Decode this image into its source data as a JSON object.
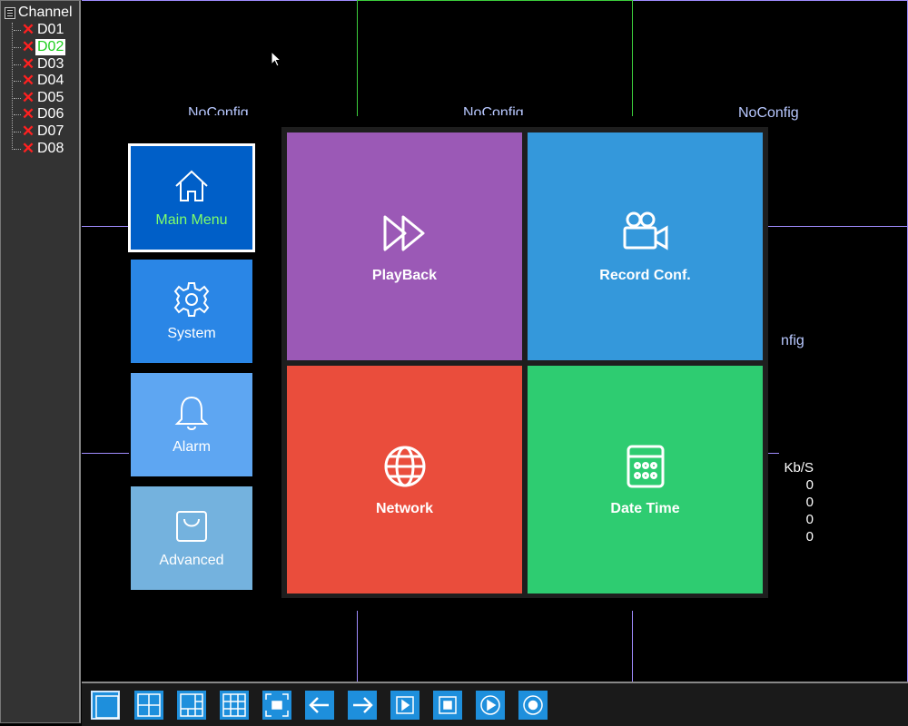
{
  "sidebar": {
    "title": "Channel",
    "channels": [
      {
        "label": "D01",
        "selected": false
      },
      {
        "label": "D02",
        "selected": true
      },
      {
        "label": "D03",
        "selected": false
      },
      {
        "label": "D04",
        "selected": false
      },
      {
        "label": "D05",
        "selected": false
      },
      {
        "label": "D06",
        "selected": false
      },
      {
        "label": "D07",
        "selected": false
      },
      {
        "label": "D08",
        "selected": false
      }
    ]
  },
  "video": {
    "noconfig_text": "NoConfig",
    "noconfig_partial": "nfig",
    "bitrate_header": "Kb/S",
    "bitrate_values": [
      "0",
      "0",
      "0",
      "0"
    ]
  },
  "nav": {
    "main_menu": "Main Menu",
    "system": "System",
    "alarm": "Alarm",
    "advanced": "Advanced"
  },
  "tiles": {
    "playback": "PlayBack",
    "record": "Record Conf.",
    "network": "Network",
    "datetime": "Date Time"
  },
  "toolbar": {
    "buttons": [
      "single-view-icon",
      "quad-view-icon",
      "six-view-icon",
      "nine-view-icon",
      "fullscreen-icon",
      "previous-arrow-icon",
      "next-arrow-icon",
      "play-icon",
      "stop-icon",
      "playback-icon",
      "record-icon"
    ]
  },
  "colors": {
    "playback": "#9b59b6",
    "record": "#3498db",
    "network": "#ea4d3c",
    "datetime": "#2ecc71",
    "main_menu": "#005fc8",
    "toolbar_button": "#1e8fdc"
  }
}
